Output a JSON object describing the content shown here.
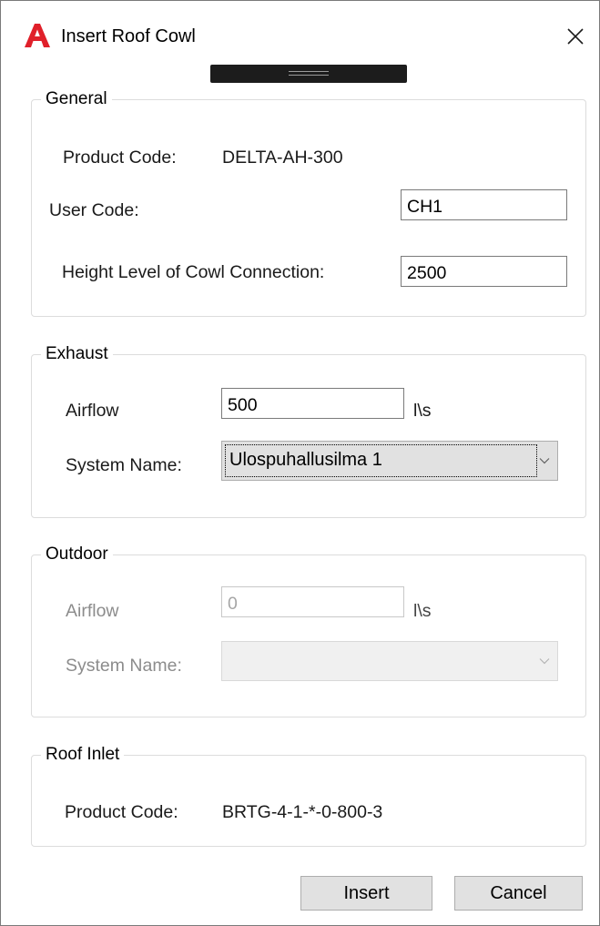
{
  "window": {
    "title": "Insert Roof Cowl"
  },
  "general": {
    "legend": "General",
    "product_code_label": "Product Code:",
    "product_code_value": "DELTA-AH-300",
    "user_code_label": "User Code:",
    "user_code_value": "CH1",
    "height_label": "Height Level of Cowl Connection:",
    "height_value": "2500"
  },
  "exhaust": {
    "legend": "Exhaust",
    "airflow_label": "Airflow",
    "airflow_value": "500",
    "airflow_unit": "l\\s",
    "system_name_label": "System Name:",
    "system_name_value": "Ulospuhallusilma 1"
  },
  "outdoor": {
    "legend": "Outdoor",
    "airflow_label": "Airflow",
    "airflow_value": "0",
    "airflow_unit": "l\\s",
    "system_name_label": "System Name:",
    "system_name_value": ""
  },
  "roof_inlet": {
    "legend": "Roof Inlet",
    "product_code_label": "Product Code:",
    "product_code_value": "BRTG-4-1-*-0-800-3"
  },
  "buttons": {
    "insert": "Insert",
    "cancel": "Cancel"
  },
  "colors": {
    "app_icon": "#e0202a",
    "disabled_text": "#8c8c8c",
    "button_bg": "#e1e1e1"
  },
  "icons": {
    "app": "autocad-logo-icon",
    "close": "close-icon",
    "dropdown": "chevron-down-icon"
  }
}
